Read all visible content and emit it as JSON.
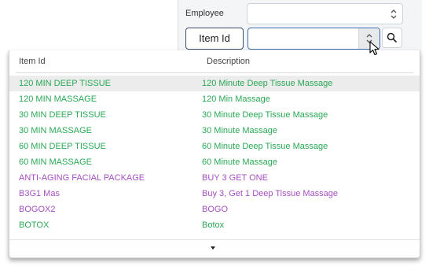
{
  "filters": {
    "employee_label": "Employee",
    "employee_value": "",
    "item_id_button_label": "Item Id",
    "item_id_value": ""
  },
  "dropdown": {
    "columns": {
      "item_id": "Item Id",
      "description": "Description"
    },
    "rows": [
      {
        "item_id": "120 MIN DEEP TISSUE",
        "description": "120 Minute Deep Tissue Massage",
        "color": "#2aa855",
        "highlighted": true
      },
      {
        "item_id": "120 MIN MASSAGE",
        "description": "120 Min Massage",
        "color": "#2aa855"
      },
      {
        "item_id": "30 MIN DEEP TISSUE",
        "description": "30 Minute Deep Tissue Massage",
        "color": "#2aa855"
      },
      {
        "item_id": "30 MIN MASSAGE",
        "description": "30 Minute Massage",
        "color": "#2aa855"
      },
      {
        "item_id": "60 MIN DEEP TISSUE",
        "description": "60 Minute Deep Tissue Massage",
        "color": "#2aa855"
      },
      {
        "item_id": "60 MIN MASSAGE",
        "description": "60 Minute Massage",
        "color": "#2aa855"
      },
      {
        "item_id": "ANTI-AGING FACIAL PACKAGE",
        "description": "BUY 3 GET ONE",
        "color": "#a64fc0"
      },
      {
        "item_id": "B3G1 Mas",
        "description": "Buy 3, Get 1 Deep Tissue Massage",
        "color": "#a64fc0"
      },
      {
        "item_id": "BOGOX2",
        "description": "BOGO",
        "color": "#a64fc0"
      },
      {
        "item_id": "BOTOX",
        "description": "Botox",
        "color": "#2aa855"
      }
    ],
    "footer_icon": "caret-down-icon"
  },
  "colors": {
    "active": "#2aa855",
    "package": "#a64fc0",
    "highlight_row": "#ececec"
  }
}
